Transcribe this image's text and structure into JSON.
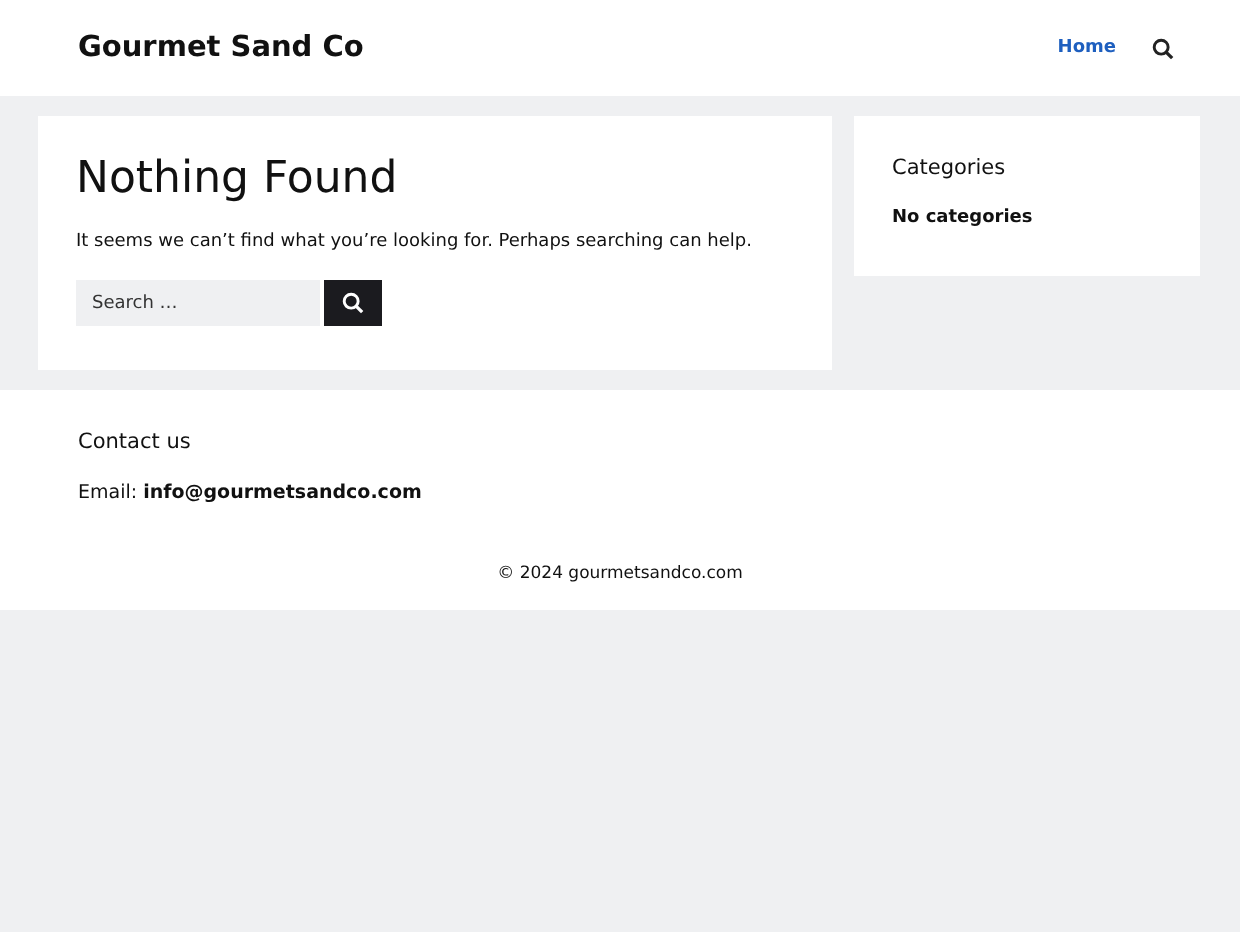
{
  "header": {
    "site_title": "Gourmet Sand Co",
    "nav": [
      {
        "label": "Home",
        "selected": true
      }
    ]
  },
  "main": {
    "title": "Nothing Found",
    "message": "It seems we can’t find what you’re looking for. Perhaps searching can help.",
    "search": {
      "placeholder": "Search …"
    }
  },
  "sidebar": {
    "title": "Categories",
    "text": "No categories"
  },
  "footer": {
    "title": "Contact us",
    "email": "Email: **info@gourmetsandco.com**",
    "copyright": "© 2024 gourmetsandco.com"
  }
}
